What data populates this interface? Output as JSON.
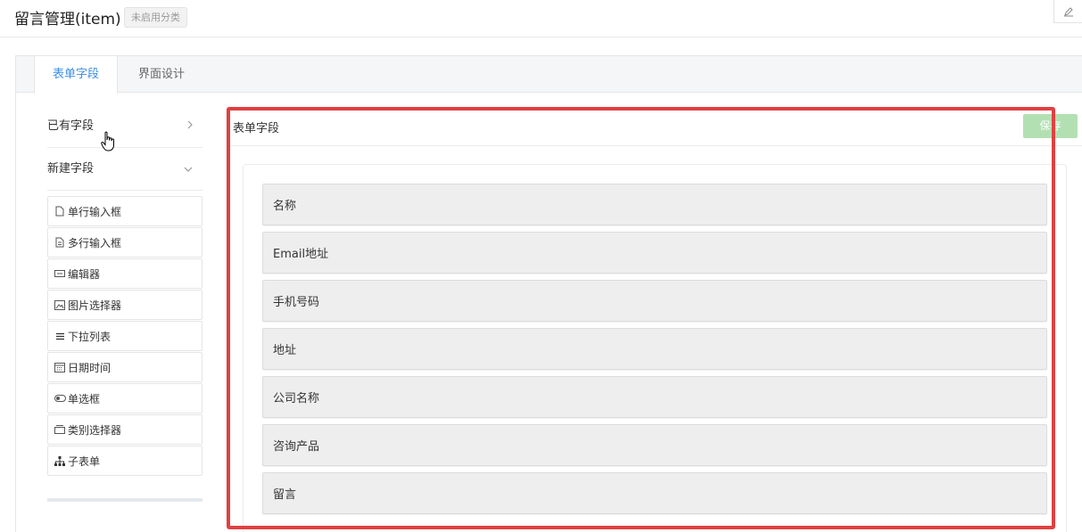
{
  "header": {
    "title": "留言管理(item)",
    "badge": "未启用分类"
  },
  "tabs": [
    {
      "label": "表单字段",
      "active": true
    },
    {
      "label": "界面设计",
      "active": false
    }
  ],
  "sidebar": {
    "existing_fields": "已有字段",
    "new_fields": "新建字段",
    "items": [
      {
        "label": "单行输入框",
        "icon": "file-icon"
      },
      {
        "label": "多行输入框",
        "icon": "file-text-icon"
      },
      {
        "label": "编辑器",
        "icon": "editor-icon"
      },
      {
        "label": "图片选择器",
        "icon": "image-icon"
      },
      {
        "label": "下拉列表",
        "icon": "list-icon"
      },
      {
        "label": "日期时间",
        "icon": "calendar-icon"
      },
      {
        "label": "单选框",
        "icon": "toggle-icon"
      },
      {
        "label": "类别选择器",
        "icon": "folder-icon"
      },
      {
        "label": "子表单",
        "icon": "sitemap-icon"
      }
    ]
  },
  "content": {
    "title": "表单字段",
    "save_label": "保存",
    "fields": [
      "名称",
      "Email地址",
      "手机号码",
      "地址",
      "公司名称",
      "咨询产品",
      "留言"
    ]
  },
  "colors": {
    "accent": "#3a8ee6",
    "highlight": "#e04040",
    "save": "#b3e0b3"
  }
}
